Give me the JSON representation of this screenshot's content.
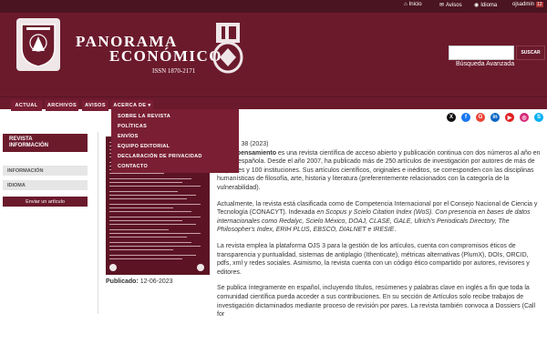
{
  "topbar": {
    "items": [
      {
        "icon": "home-icon",
        "label": "Inicio"
      },
      {
        "icon": "megaphone-icon",
        "label": "Avisos"
      },
      {
        "icon": "globe-icon",
        "label": "Idioma"
      },
      {
        "icon": "user-icon",
        "label": "ojsadmin"
      }
    ],
    "user_badge": "12"
  },
  "header": {
    "title_line1": "PANORAMA",
    "title_line2": "ECONÓMICO",
    "issn": "ISSN 1870-2171",
    "search_button": "SUSCAR",
    "advanced_search": "Búsqueda Avanzada"
  },
  "nav": {
    "items": [
      "ACTUAL",
      "ARCHIVOS",
      "AVISOS",
      "ACERCA DE ▾"
    ]
  },
  "dropdown": {
    "items": [
      "SOBRE LA REVISTA",
      "POLÍTICAS",
      "ENVÍOS",
      "EQUIPO EDITORIAL",
      "DECLARACIÓN DE PRIVACIDAD",
      "CONTACTO"
    ]
  },
  "social": {
    "icons": [
      {
        "name": "x-icon",
        "glyph": "X",
        "color": "#111111"
      },
      {
        "name": "facebook-icon",
        "glyph": "f",
        "color": "#1877f2"
      },
      {
        "name": "google-icon",
        "glyph": "G",
        "color": "#ea4335"
      },
      {
        "name": "linkedin-icon",
        "glyph": "in",
        "color": "#0a66c2"
      },
      {
        "name": "youtube-icon",
        "glyph": "▶",
        "color": "#e02020"
      },
      {
        "name": "instagram-icon",
        "glyph": "◎",
        "color": "#d6297a"
      },
      {
        "name": "skype-icon",
        "glyph": "S",
        "color": "#00aff0"
      },
      {
        "name": "share-icon",
        "glyph": "⇪",
        "color": "#2a60b0"
      }
    ]
  },
  "sidebar": {
    "title_line1": "REVISTA",
    "title_line2": "INFORMACIÓN",
    "items": [
      "INFORMACIÓN",
      "IDIOMA"
    ],
    "submit_button": "Enviar un artículo"
  },
  "cover": {
    "published_label": "Publicado:",
    "published_date": "12-06-2023"
  },
  "content": {
    "p1_start": "...",
    "p1_issue": "Núm. 38 (2023)",
    "p1_bold": "es del pensamiento",
    "p1_text": " es una revista científica de acceso abierto y publicación continua con dos números al año en lengua española. Desde el año 2007, ha publicado  más de 250 artículos de investigación por autores de  más de 20 países y 100 instituciones. Sus artículos científicos, originales e inéditos, se corresponden con las disciplinas humanísticas de filosofía, arte, historia y literatura (preferentemente relacionados con la categoría de la vulnerabilidad).",
    "p2_a": "Actualmente, la revista está clasificada como de Competencia Internacional por el Consejo Nacional de Ciencia y Tecnología (CONACYT). Indexada ",
    "p2_b": "en Scopus y  Scielo Citation Index (WoS).  Con presencia en bases de datos internacionales como Redalyc, Scielo México, DOAJ, CLASE, GALE, Ulrich's Periodicals Directory, The Philosopher's Index, ERIH PLUS, EBSCO, DIALNET e IRESIE",
    "p2_c": ".",
    "p3": "La revista emplea la plataforma OJS 3 para la gestión de los artículos, cuenta con compromisos éticos de transparencia y puntualidad, sistemas de antiplagio (Ithenticate), métricas alternativas (PlumX), DOIs, ORCID, pdfs, xml y redes sociales. Asimismo, la revista cuenta con un código ético compartido por autores, revisores y editores.",
    "p4": "Se publica íntegramente en español, incluyendo títulos, resúmenes y palabras clave en inglés a fin que toda la comunidad científica pueda acceder a sus contribuciones. En su sección de Artículos solo recibe trabajos de investigación dictaminados mediante proceso de revisión por pares.  La revista también convoca a Dossiers (Call for"
  }
}
